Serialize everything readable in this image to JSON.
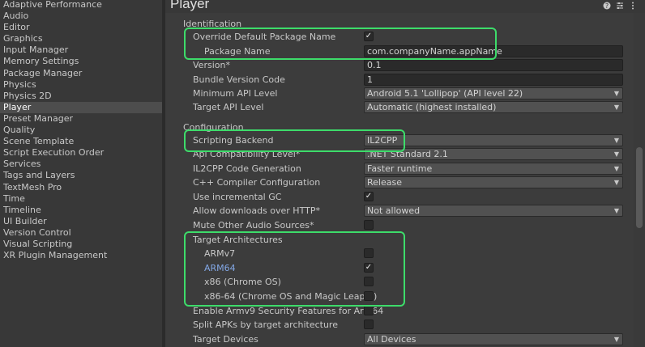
{
  "sidebar": {
    "items": [
      {
        "label": "Adaptive Performance",
        "selected": false
      },
      {
        "label": "Audio",
        "selected": false
      },
      {
        "label": "Editor",
        "selected": false
      },
      {
        "label": "Graphics",
        "selected": false
      },
      {
        "label": "Input Manager",
        "selected": false
      },
      {
        "label": "Memory Settings",
        "selected": false
      },
      {
        "label": "Package Manager",
        "selected": false
      },
      {
        "label": "Physics",
        "selected": false
      },
      {
        "label": "Physics 2D",
        "selected": false
      },
      {
        "label": "Player",
        "selected": true
      },
      {
        "label": "Preset Manager",
        "selected": false
      },
      {
        "label": "Quality",
        "selected": false
      },
      {
        "label": "Scene Template",
        "selected": false
      },
      {
        "label": "Script Execution Order",
        "selected": false
      },
      {
        "label": "Services",
        "selected": false
      },
      {
        "label": "Tags and Layers",
        "selected": false
      },
      {
        "label": "TextMesh Pro",
        "selected": false
      },
      {
        "label": "Time",
        "selected": false
      },
      {
        "label": "Timeline",
        "selected": false
      },
      {
        "label": "UI Builder",
        "selected": false
      },
      {
        "label": "Version Control",
        "selected": false
      },
      {
        "label": "Visual Scripting",
        "selected": false
      },
      {
        "label": "XR Plugin Management",
        "selected": false
      }
    ]
  },
  "header": {
    "title": "Player",
    "icons": [
      "help-icon",
      "preset-icon",
      "menu-icon"
    ]
  },
  "identification": {
    "section_title": "Identification",
    "override_label": "Override Default Package Name",
    "override_checked": true,
    "package_name_label": "Package Name",
    "package_name_value": "com.companyName.appName",
    "version_label": "Version*",
    "version_value": "0.1",
    "bundle_label": "Bundle Version Code",
    "bundle_value": "1",
    "min_api_label": "Minimum API Level",
    "min_api_value": "Android 5.1 'Lollipop' (API level 22)",
    "target_api_label": "Target API Level",
    "target_api_value": "Automatic (highest installed)"
  },
  "configuration": {
    "section_title": "Configuration",
    "scripting_backend_label": "Scripting Backend",
    "scripting_backend_value": "IL2CPP",
    "api_compat_label": "Api Compatibility Level*",
    "api_compat_value": ".NET Standard 2.1",
    "il2cpp_gen_label": "IL2CPP Code Generation",
    "il2cpp_gen_value": "Faster runtime",
    "cpp_config_label": "C++ Compiler Configuration",
    "cpp_config_value": "Release",
    "incremental_gc_label": "Use incremental GC",
    "incremental_gc_checked": true,
    "http_label": "Allow downloads over HTTP*",
    "http_value": "Not allowed",
    "mute_audio_label": "Mute Other Audio Sources*",
    "mute_audio_checked": false,
    "target_arch_label": "Target Architectures",
    "arch_armv7_label": "ARMv7",
    "arch_armv7_checked": false,
    "arch_arm64_label": "ARM64",
    "arch_arm64_checked": true,
    "arch_x86_label": "x86 (Chrome OS)",
    "arch_x86_checked": false,
    "arch_x8664_label": "x86-64 (Chrome OS and Magic Leap 2)",
    "arch_x8664_checked": false,
    "armv9_label": "Enable Armv9 Security Features for Arm64",
    "armv9_checked": false,
    "split_apks_label": "Split APKs by target architecture",
    "split_apks_checked": false,
    "target_devices_label": "Target Devices",
    "target_devices_value": "All Devices"
  },
  "colors": {
    "highlight": "#3ddc6a",
    "background": "#383838",
    "selected": "#4d4d4d",
    "arm64_label": "#83a8e6"
  }
}
